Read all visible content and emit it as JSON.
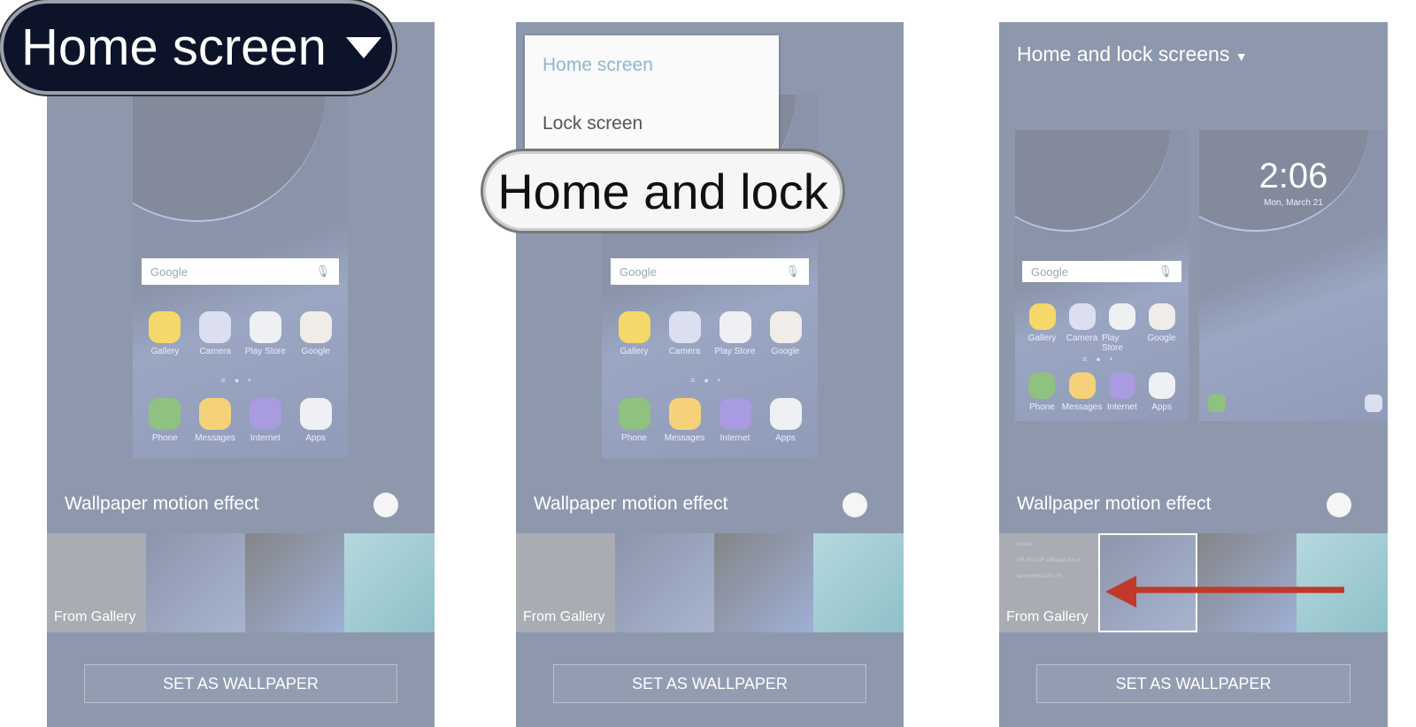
{
  "callouts": {
    "home_screen": "Home screen",
    "home_and_lock": "Home and lock"
  },
  "dropdown": {
    "items": [
      "Home screen",
      "Lock screen"
    ],
    "selected_color": "#8fb6d0"
  },
  "panel3": {
    "title": "Home and lock screens"
  },
  "preview": {
    "search": "Google",
    "apps": [
      "Gallery",
      "Camera",
      "Play Store",
      "Google"
    ],
    "dock": [
      "Phone",
      "Messages",
      "Internet",
      "Apps"
    ]
  },
  "lock": {
    "time": "2:06",
    "date": "Mon, March 21"
  },
  "motion_label": "Wallpaper motion effect",
  "from_gallery": "From Gallery",
  "set_button": "SET AS WALLPAPER",
  "gallery_list": [
    "timber",
    "HP-Print-9F-Officejet Pro 8..",
    "sammityme200 1'S"
  ],
  "colors": {
    "panel": "#8e98ad",
    "callout_dark": "#0d1328",
    "arrow": "#c0392b"
  }
}
